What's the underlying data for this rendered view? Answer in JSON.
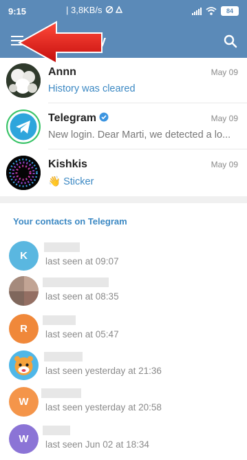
{
  "status_bar": {
    "time": "9:15",
    "extra": "| 3,8KB/s",
    "battery": "84",
    "icons": [
      "data-saver-icon",
      "wifi-icon",
      "signal-icon",
      "battery-icon"
    ]
  },
  "app_bar": {
    "title": "tory",
    "menu_icon": "hamburger-icon",
    "search_icon": "search-icon"
  },
  "chats": [
    {
      "name": "Annn",
      "date": "May 09",
      "message": "History was cleared",
      "message_highlight": true
    },
    {
      "name": "Telegram",
      "verified": true,
      "date": "May 09",
      "message": "New login. Dear Marti, we detected a lo...",
      "message_highlight": false
    },
    {
      "name": "Kishkis",
      "date": "May 09",
      "message": "👋 Sticker",
      "message_highlight": true
    }
  ],
  "contacts_section": {
    "header": "Your contacts on Telegram",
    "contacts": [
      {
        "initial": "K",
        "color": "#5ab7e0",
        "last_seen": "last seen at 09:07"
      },
      {
        "initial": "",
        "color": "#9a7f72",
        "last_seen": "last seen at 08:35"
      },
      {
        "initial": "R",
        "color": "#f0883a",
        "last_seen": "last seen at 05:47"
      },
      {
        "initial": "",
        "color": "#4fb7e8",
        "last_seen": "last seen yesterday at 21:36"
      },
      {
        "initial": "W",
        "color": "#f4954a",
        "last_seen": "last seen yesterday at 20:58"
      },
      {
        "initial": "W",
        "color": "#8b74d6",
        "last_seen": "last seen Jun 02 at 18:34"
      }
    ]
  },
  "colors": {
    "header": "#5b8ab8",
    "accent": "#3b88c3",
    "arrow": "#e11b1b"
  }
}
